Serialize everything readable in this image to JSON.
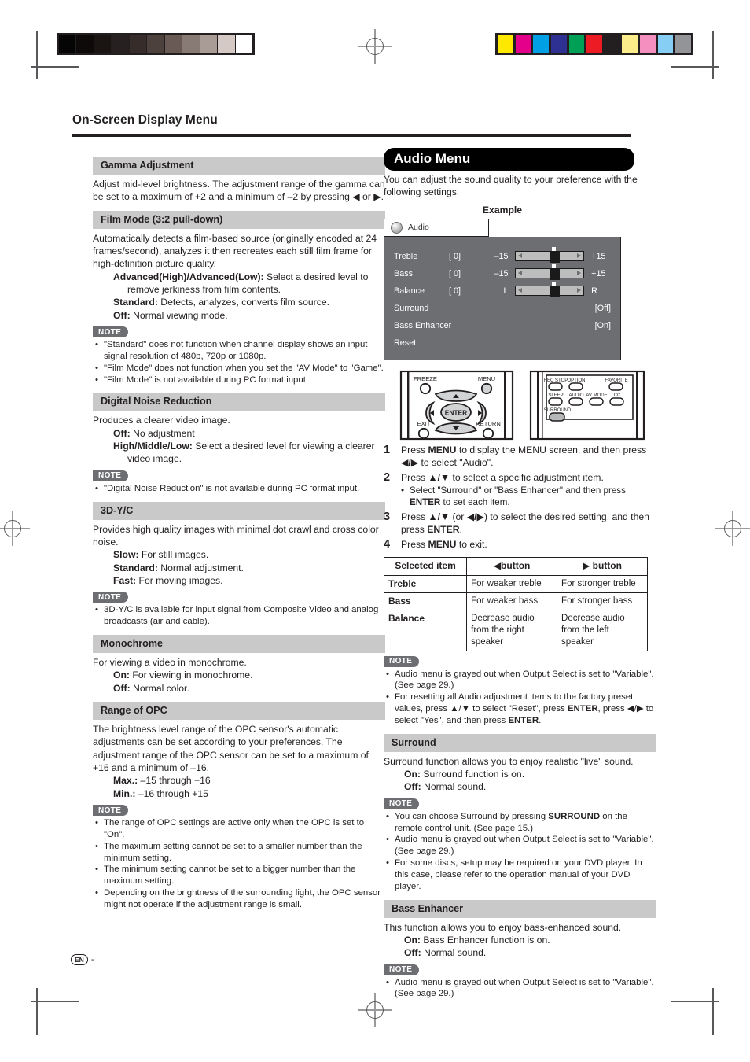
{
  "page": {
    "running_head": "On-Screen Display Menu",
    "folio_locale": "EN",
    "folio_dash": "-"
  },
  "print_marks": {
    "step_wedge": [
      "#050505",
      "#0d0a09",
      "#1a1513",
      "#272020",
      "#362d2b",
      "#4d413e",
      "#6a5a56",
      "#887a75",
      "#a99b96",
      "#d4c9c5",
      "#ffffff"
    ],
    "color_bar": [
      "#ffe800",
      "#e5008c",
      "#00a0e4",
      "#2e3192",
      "#00a057",
      "#ed1c24",
      "#231f20",
      "#fbee8a",
      "#f48fc0",
      "#86cef4",
      "#929497"
    ]
  },
  "left_column": {
    "sections": [
      {
        "title": "Gamma Adjustment",
        "body": "Adjust mid-level brightness. The adjustment range of the gamma can be set to a maximum of +2 and a minimum of –2 by pressing ◀ or ▶.",
        "options": [],
        "notes": []
      },
      {
        "title": "Film Mode (3:2 pull-down)",
        "body": "Automatically detects a film-based source (originally encoded at 24 frames/second), analyzes it then recreates each still film frame for high-definition picture quality.",
        "options": [
          {
            "term": "Advanced(High)/Advanced(Low):",
            "desc": " Select a desired level to remove jerkiness from film contents."
          },
          {
            "term": "Standard:",
            "desc": " Detects, analyzes, converts film source."
          },
          {
            "term": "Off:",
            "desc": " Normal viewing mode."
          }
        ],
        "notes": [
          "\"Standard\" does not function when channel display shows an input signal resolution of 480p, 720p or 1080p.",
          "\"Film Mode\" does not function when you set the \"AV Mode\" to \"Game\".",
          "\"Film Mode\" is not available during PC format input."
        ]
      },
      {
        "title": "Digital Noise Reduction",
        "body": "Produces a clearer video image.",
        "options": [
          {
            "term": "Off:",
            "desc": " No adjustment"
          },
          {
            "term": "High/Middle/Low:",
            "desc": " Select a desired level for viewing a clearer video image."
          }
        ],
        "notes": [
          "\"Digital Noise Reduction\" is not available during PC format input."
        ]
      },
      {
        "title": "3D-Y/C",
        "body": "Provides high quality images with minimal dot crawl and cross color noise.",
        "options": [
          {
            "term": "Slow:",
            "desc": " For still images."
          },
          {
            "term": "Standard:",
            "desc": " Normal adjustment."
          },
          {
            "term": "Fast:",
            "desc": " For moving images."
          }
        ],
        "notes": [
          "3D-Y/C is available for input signal from Composite Video and analog broadcasts (air and cable)."
        ]
      },
      {
        "title": "Monochrome",
        "body": "For viewing a video in monochrome.",
        "options": [
          {
            "term": "On:",
            "desc": " For viewing in monochrome."
          },
          {
            "term": "Off:",
            "desc": " Normal color."
          }
        ],
        "notes": []
      },
      {
        "title": "Range of OPC",
        "body": "The brightness level range of the OPC sensor's automatic adjustments can be set according to your preferences. The adjustment range of the OPC sensor can be set to a maximum of +16 and a minimum of –16.",
        "options": [
          {
            "term": "Max.:",
            "desc": " –15 through +16"
          },
          {
            "term": "Min.:",
            "desc": " –16 through +15"
          }
        ],
        "notes": [
          "The range of OPC settings are active only when the OPC is set to \"On\".",
          "The maximum setting cannot be set to a smaller number than the minimum setting.",
          "The minimum setting cannot be set to a bigger number than the maximum setting.",
          "Depending on the brightness of the surrounding light, the OPC sensor might not operate if the adjustment range is small."
        ]
      }
    ],
    "note_tag": "NOTE"
  },
  "right_column": {
    "audio_menu_title": "Audio Menu",
    "audio_menu_intro": "You can adjust the sound quality to your preference with the following settings.",
    "example_label": "Example",
    "osd": {
      "tab_label": "Audio",
      "tab_icon": "speaker-icon",
      "rows": [
        {
          "label": "Treble",
          "value": "[ 0]",
          "min": "–15",
          "max": "+15",
          "type": "slider"
        },
        {
          "label": "Bass",
          "value": "[ 0]",
          "min": "–15",
          "max": "+15",
          "type": "slider"
        },
        {
          "label": "Balance",
          "value": "[ 0]",
          "min": "L",
          "max": "R",
          "type": "slider"
        },
        {
          "label": "Surround",
          "state": "[Off]",
          "type": "state"
        },
        {
          "label": "Bass Enhancer",
          "state": "[On]",
          "type": "state"
        },
        {
          "label": "Reset",
          "state": "",
          "type": "state"
        }
      ]
    },
    "remote_left": {
      "buttons": [
        "FREEZE",
        "MENU",
        "EXIT",
        "RETURN",
        "ENTER"
      ]
    },
    "remote_right": {
      "row1": [
        "REC STOP",
        "OPTION",
        "FAVORITE"
      ],
      "row2": [
        "SLEEP",
        "AUDIO",
        "AV MODE",
        "CC"
      ],
      "row3": [
        "SURROUND"
      ]
    },
    "steps": [
      {
        "num": "1",
        "html": "Press <b>MENU</b> to display the MENU screen, and then press <b>◀/▶</b> to select \"Audio\".",
        "sub": []
      },
      {
        "num": "2",
        "html": "Press <b>▲/▼</b> to select a specific adjustment item.",
        "sub": [
          "Select \"Surround\" or \"Bass Enhancer\" and then press <b>ENTER</b> to set each item."
        ]
      },
      {
        "num": "3",
        "html": "Press <b>▲/▼</b> (or <b>◀/▶</b>) to select the desired setting, and then press <b>ENTER</b>.",
        "sub": []
      },
      {
        "num": "4",
        "html": "Press <b>MENU</b> to exit.",
        "sub": []
      }
    ],
    "button_table": {
      "headers": [
        "Selected item",
        "◀button",
        "▶ button"
      ],
      "rows": [
        [
          "Treble",
          "For weaker treble",
          "For stronger treble"
        ],
        [
          "Bass",
          "For weaker bass",
          "For stronger bass"
        ],
        [
          "Balance",
          "Decrease audio from the right speaker",
          "Decrease audio from the left speaker"
        ]
      ]
    },
    "note_tag": "NOTE",
    "audio_notes": [
      "Audio menu is grayed out when Output Select is set to \"Variable\". (See page 29.)",
      "For resetting all Audio adjustment items to the factory preset values, press ▲/▼ to select \"Reset\", press <b>ENTER</b>, press ◀/▶ to select \"Yes\", and then press <b>ENTER</b>."
    ],
    "surround": {
      "title": "Surround",
      "body": "Surround function allows you to enjoy realistic \"live\" sound.",
      "options": [
        {
          "term": "On:",
          "desc": " Surround function is on."
        },
        {
          "term": "Off:",
          "desc": " Normal sound."
        }
      ],
      "notes": [
        "You can choose Surround by pressing <b>SURROUND</b> on the remote control unit. (See page 15.)",
        "Audio menu is grayed out when Output Select is set to \"Variable\". (See page 29.)",
        "For some discs, setup may be required on your DVD player. In this case, please refer to the operation manual of your DVD player."
      ]
    },
    "bass_enhancer": {
      "title": "Bass Enhancer",
      "body": "This function allows you to enjoy bass-enhanced sound.",
      "options": [
        {
          "term": "On:",
          "desc": " Bass Enhancer function is on."
        },
        {
          "term": "Off:",
          "desc": " Normal sound."
        }
      ],
      "notes": [
        "Audio menu is grayed out when Output Select is set to \"Variable\". (See page 29.)"
      ]
    }
  }
}
